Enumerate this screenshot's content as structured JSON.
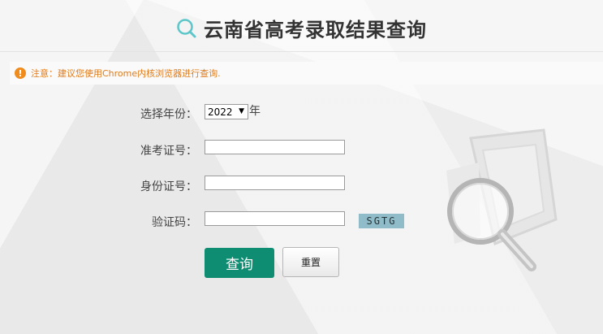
{
  "page": {
    "title": "云南省高考录取结果查询"
  },
  "notice": {
    "icon": "exclamation",
    "text": "注意：建议您使用Chrome内核浏览器进行查询."
  },
  "form": {
    "year_label": "选择年份：",
    "year_value": "2022",
    "year_suffix": "年",
    "exam_no_label": "准考证号：",
    "exam_no_value": "",
    "id_no_label": "身份证号：",
    "id_no_value": "",
    "captcha_label": "验证码：",
    "captcha_value": "",
    "captcha_text": "SGTG"
  },
  "buttons": {
    "query": "查询",
    "reset": "重置"
  },
  "colors": {
    "primary": "#0f8d72",
    "notice": "#e07b1a",
    "captcha_bg": "#8fbcc8"
  }
}
